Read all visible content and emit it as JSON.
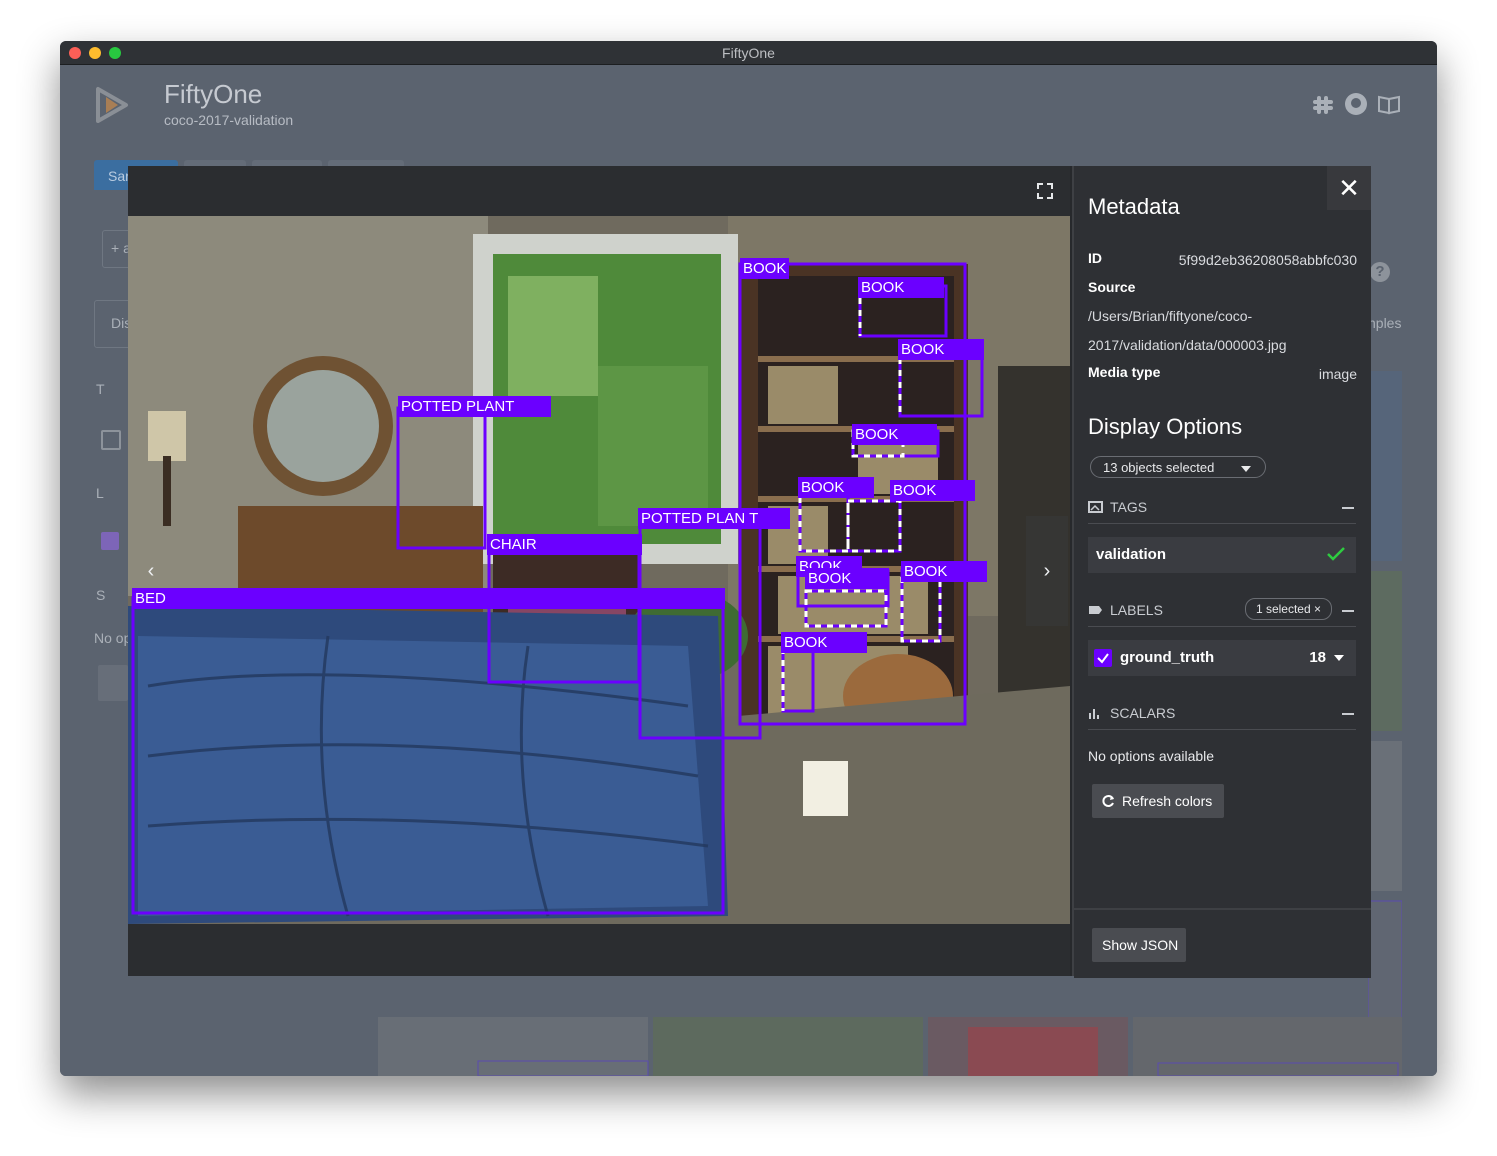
{
  "window": {
    "title": "FiftyOne"
  },
  "header": {
    "brand": "FiftyOne",
    "dataset": "coco-2017-validation"
  },
  "background": {
    "tab_fragment": "Sar",
    "add_fragment": "+ a",
    "dis_fragment": "Dis",
    "t_fragment": "T",
    "l_fragment": "L",
    "s_fragment": "S",
    "noop_fragment": "No op",
    "samples_fragment": "nples"
  },
  "viewer": {
    "detections": [
      {
        "label": "BOOK"
      },
      {
        "label": "BOOK"
      },
      {
        "label": "BOOK"
      },
      {
        "label": "POTTED PLANT"
      },
      {
        "label": "BOOK"
      },
      {
        "label": "BOOK"
      },
      {
        "label": "BOOK"
      },
      {
        "label": "POTTED PLAN T"
      },
      {
        "label": "CHAIR"
      },
      {
        "label": "BOOK"
      },
      {
        "label": "BOOK"
      },
      {
        "label": "BOOK"
      },
      {
        "label": "BED"
      },
      {
        "label": "BOOK"
      }
    ],
    "box_color": "#6b00ff"
  },
  "panel": {
    "metadata_title": "Metadata",
    "id_label": "ID",
    "id_value": "5f99d2eb36208058abbfc030",
    "source_label": "Source",
    "source_line1": "/Users/Brian/fiftyone/coco-",
    "source_line2": "2017/validation/data/000003.jpg",
    "media_type_label": "Media type",
    "media_type_value": "image",
    "display_options_title": "Display Options",
    "objects_selected": "13 objects selected",
    "tags_title": "TAGS",
    "tag_value": "validation",
    "labels_title": "LABELS",
    "labels_selected": "1 selected ×",
    "field_name": "ground_truth",
    "field_count": "18",
    "scalars_title": "SCALARS",
    "no_options": "No options available",
    "refresh_colors": "Refresh colors",
    "show_json": "Show JSON",
    "accent_color": "#6b00ff",
    "check_color": "#2ecc40"
  }
}
